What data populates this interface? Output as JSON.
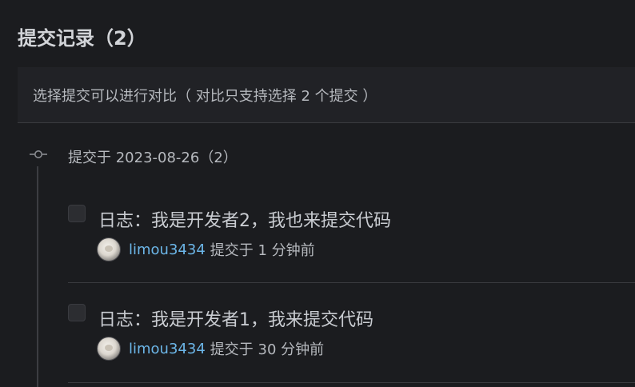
{
  "header": {
    "title": "提交记录（2）"
  },
  "hint": {
    "text": "选择提交可以进行对比（ 对比只支持选择 2 个提交 ）"
  },
  "group": {
    "label": "提交于 2023-08-26（2）"
  },
  "commits": [
    {
      "message": "日志：我是开发者2，我也来提交代码",
      "author": "limou3434",
      "time": "提交于 1 分钟前",
      "checked": false
    },
    {
      "message": "日志：我是开发者1，我来提交代码",
      "author": "limou3434",
      "time": "提交于 30 分钟前",
      "checked": false
    }
  ],
  "colors": {
    "background": "#1b1c1f",
    "hint_background": "#212226",
    "author_link": "#6cb6e8",
    "text": "#c9ccd1"
  }
}
